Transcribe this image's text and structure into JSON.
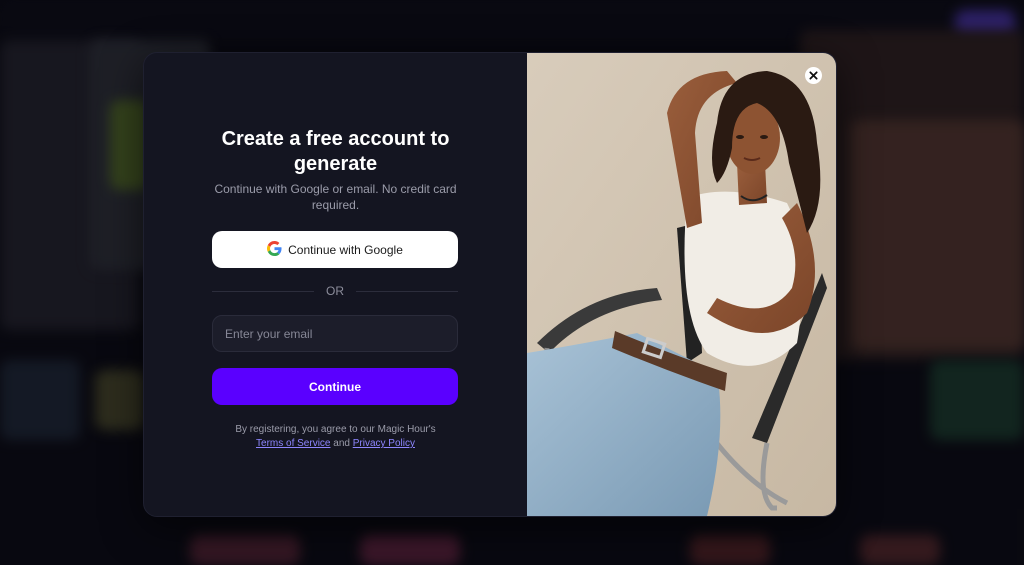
{
  "modal": {
    "title": "Create a free account to generate",
    "subtitle": "Continue with Google or email. No credit card required.",
    "google_button_label": "Continue with Google",
    "divider_text": "OR",
    "email_placeholder": "Enter your email",
    "email_value": "",
    "continue_label": "Continue",
    "legal_prefix": "By registering, you agree to our Magic Hour's",
    "terms_label": "Terms of Service",
    "legal_and": "and",
    "privacy_label": "Privacy Policy",
    "close_icon": "close-icon",
    "image_alt": "model-photo"
  },
  "colors": {
    "modal_bg": "#141521",
    "accent": "#5a00ff",
    "link": "#8e86ff",
    "text_muted": "#9b9caa"
  }
}
